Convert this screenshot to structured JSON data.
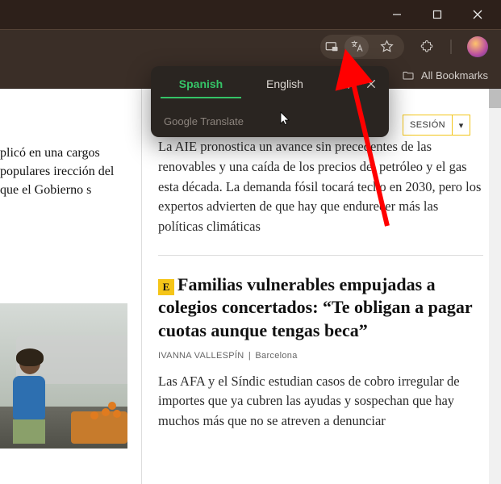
{
  "window": {
    "minimize_icon": "minimize",
    "maximize_icon": "maximize",
    "close_icon": "close"
  },
  "toolbar": {
    "cast_icon": "screen-pip",
    "translate_icon": "translate",
    "star_icon": "star",
    "extensions_icon": "puzzle",
    "profile_icon": "avatar"
  },
  "bookmarks_bar": {
    "folder_icon": "folder",
    "label": "All Bookmarks"
  },
  "translate_popup": {
    "tabs": [
      "Spanish",
      "English"
    ],
    "active_tab_index": 0,
    "brand": "Google Translate",
    "menu_icon": "kebab",
    "close_icon": "close"
  },
  "page_content": {
    "sesion": {
      "label": "SESIÓN",
      "caret": "▾"
    },
    "left_snippet": "plicó en una cargos populares irección del que el Gobierno s",
    "art1": {
      "body": "La AIE pronostica un avance sin precedentes de las renovables y una caída de los precios del petróleo y el gas esta década. La demanda fósil tocará techo en 2030, pero los expertos advierten de que hay que endurecer más las políticas climáticas"
    },
    "art2": {
      "badge": "E",
      "headline": "Familias vulnerables empujadas a colegios concertados: “Te obligan a pagar cuotas aunque tengas beca”",
      "byline_author": "IVANNA VALLESPÍN",
      "byline_sep": "|",
      "byline_loc": "Barcelona",
      "body": "Las AFA y el Síndic estudian casos de cobro irregular de importes que ya cubren las ayudas y sospechan que hay muchos más que no se atreven a denunciar"
    }
  },
  "annotation": {
    "arrow_color": "#ff0000"
  }
}
